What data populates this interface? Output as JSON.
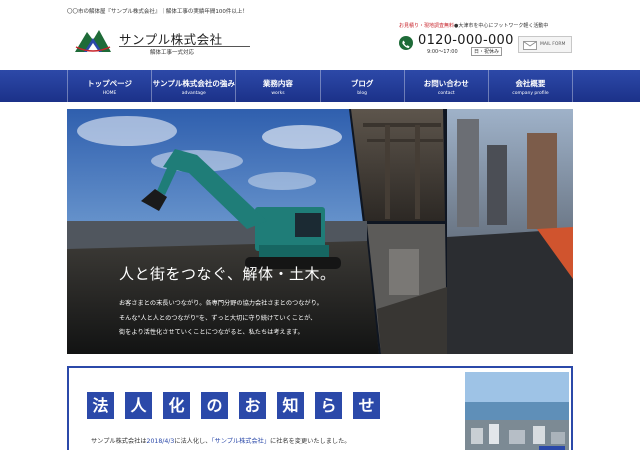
{
  "top_notice": "〇〇市の解体屋『サンプル株式会社』｜解体工事の実績年間100件以上！",
  "logo": {
    "name": "サンプル株式会社",
    "sub": "解体工事一式対応",
    "icon": "mountain-logo-icon"
  },
  "header": {
    "estimate_note": "お見積り・現地調査無料",
    "area_note": "●大津市を中心にフットワーク軽く活動中",
    "phone_number": "0120-000-000",
    "phone_hours": "9:00〜17:00",
    "phone_closed": "日・祝休み",
    "mail_label": "MAIL FORM",
    "icons": {
      "phone": "phone-icon",
      "mail": "mail-icon"
    }
  },
  "nav": {
    "items": [
      {
        "jp": "トップページ",
        "en": "HOME"
      },
      {
        "jp": "サンプル株式会社の強み",
        "en": "advantage"
      },
      {
        "jp": "業務内容",
        "en": "works"
      },
      {
        "jp": "ブログ",
        "en": "blog"
      },
      {
        "jp": "お問い合わせ",
        "en": "contact"
      },
      {
        "jp": "会社概要",
        "en": "company profile"
      }
    ]
  },
  "hero": {
    "heading": "人と街をつなぐ、解体・土木。",
    "lines": [
      "お客さまとの末長いつながり。各専門分野の協力会社さまとのつながり。",
      "そんな\"人と人とのつながり\"を、ずっと大切に守り続けていくことが、",
      "街をより活性化させていくことにつながると、私たちは考えます。"
    ]
  },
  "news": {
    "title_chars": [
      "法",
      "人",
      "化",
      "の",
      "お",
      "知",
      "ら",
      "せ"
    ],
    "text_prefix": "サンプル株式会社は",
    "text_date": "2018/4/3",
    "text_mid": "に法人化し、",
    "text_link": "「サンプル株式会社」",
    "text_suffix": "に社名を変更いたしました。"
  },
  "colors": {
    "brand_blue": "#2b49a9",
    "nav_blue": "#1b3189",
    "accent_red": "#c8242b",
    "phone_green": "#1e6b38"
  }
}
